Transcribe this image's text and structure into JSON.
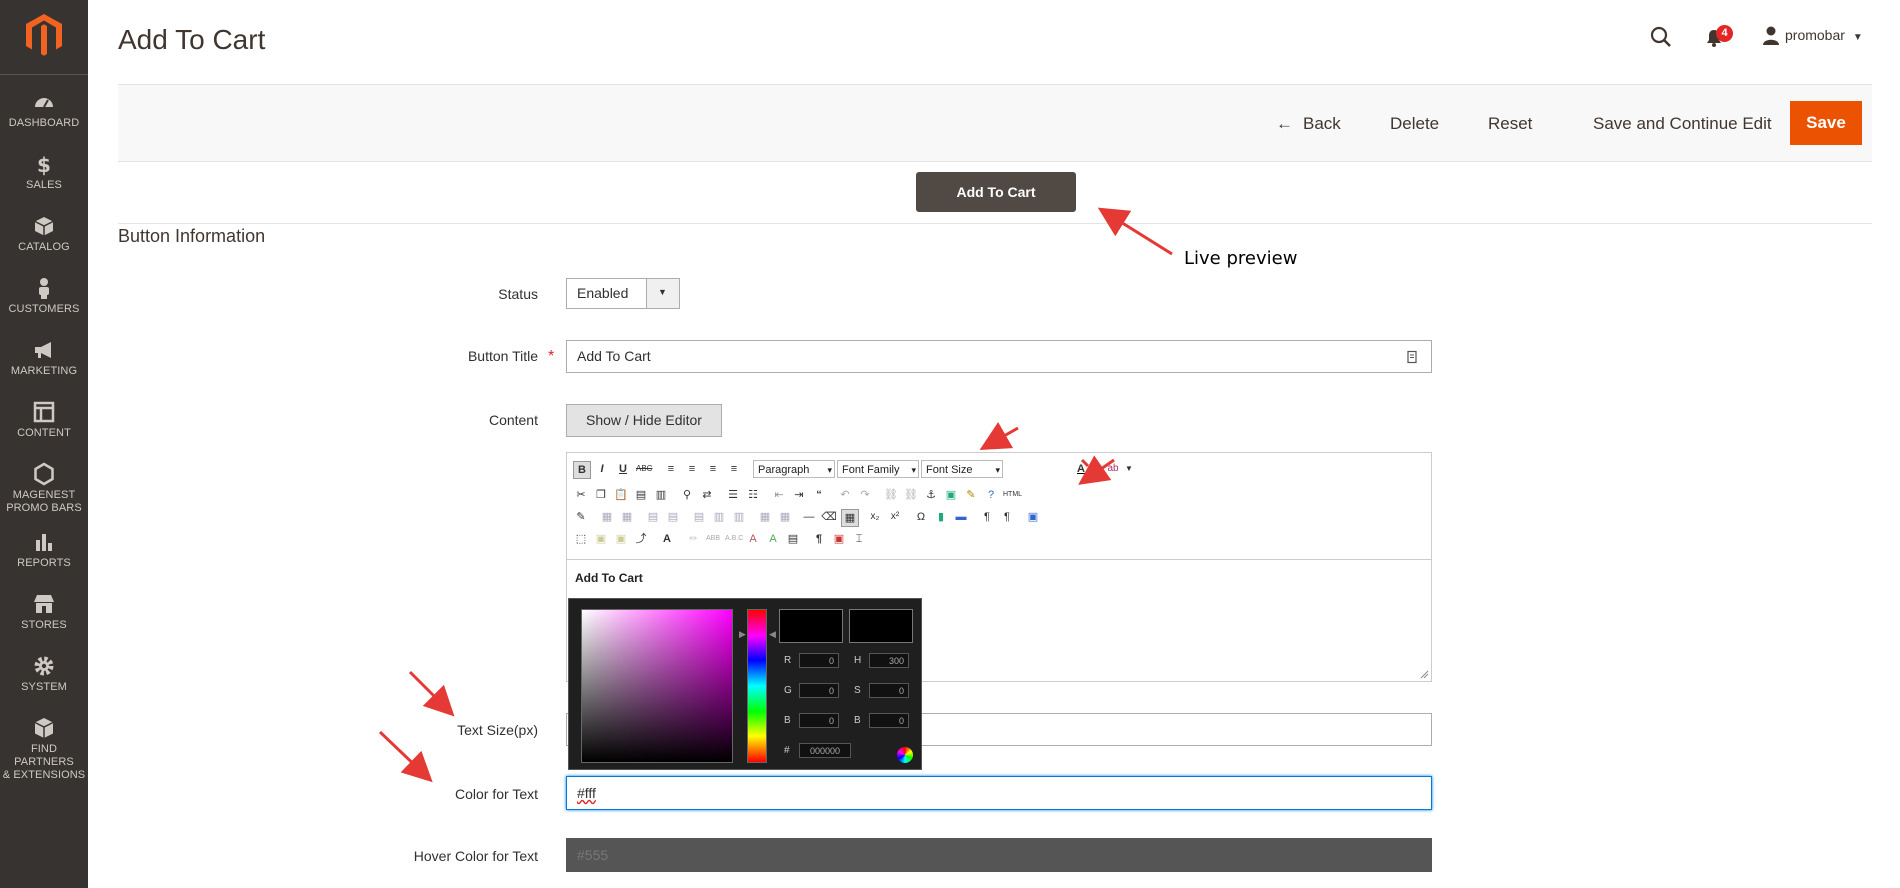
{
  "sidebar": {
    "items": [
      {
        "label": "DASHBOARD",
        "icon": "dashboard-icon"
      },
      {
        "label": "SALES",
        "icon": "dollar-icon"
      },
      {
        "label": "CATALOG",
        "icon": "box-icon"
      },
      {
        "label": "CUSTOMERS",
        "icon": "person-icon"
      },
      {
        "label": "MARKETING",
        "icon": "megaphone-icon"
      },
      {
        "label": "CONTENT",
        "icon": "layout-icon"
      },
      {
        "label": "MAGENEST",
        "label2": "PROMO BARS",
        "icon": "hexagon-icon"
      },
      {
        "label": "REPORTS",
        "icon": "bar-chart-icon"
      },
      {
        "label": "STORES",
        "icon": "store-icon"
      },
      {
        "label": "SYSTEM",
        "icon": "gear-icon"
      },
      {
        "label": "FIND PARTNERS",
        "label2": "& EXTENSIONS",
        "icon": "cube-icon"
      }
    ]
  },
  "header": {
    "title": "Add To Cart",
    "notification_count": "4",
    "user": "promobar"
  },
  "actions": {
    "back": "Back",
    "delete": "Delete",
    "reset": "Reset",
    "save_continue": "Save and Continue Edit",
    "save": "Save"
  },
  "preview": {
    "button_label": "Add To Cart",
    "annotation": "Live preview"
  },
  "section": {
    "title": "Button Information"
  },
  "form": {
    "status": {
      "label": "Status",
      "value": "Enabled"
    },
    "button_title": {
      "label": "Button Title",
      "value": "Add To Cart"
    },
    "content": {
      "label": "Content",
      "toggle": "Show / Hide Editor"
    },
    "text_size": {
      "label": "Text Size(px)",
      "value": ""
    },
    "color_text": {
      "label": "Color for Text",
      "value": "#fff"
    },
    "hover_color_text": {
      "label": "Hover Color for Text",
      "value": "#555"
    }
  },
  "editor": {
    "format_select": "Paragraph",
    "font_family_select": "Font Family",
    "font_size_select": "Font Size",
    "body_text": "Add To Cart"
  },
  "color_picker": {
    "r": "0",
    "g": "0",
    "b": "0",
    "h": "300",
    "s": "0",
    "bv": "0",
    "hex": "000000",
    "labels": {
      "r": "R",
      "g": "G",
      "b": "B",
      "h": "H",
      "s": "S",
      "bv": "B",
      "hash": "#"
    }
  },
  "colors": {
    "sidebar_bg": "#373330",
    "accent": "#eb5202",
    "preview_button": "#514943",
    "annotation_arrow": "#e53935"
  }
}
